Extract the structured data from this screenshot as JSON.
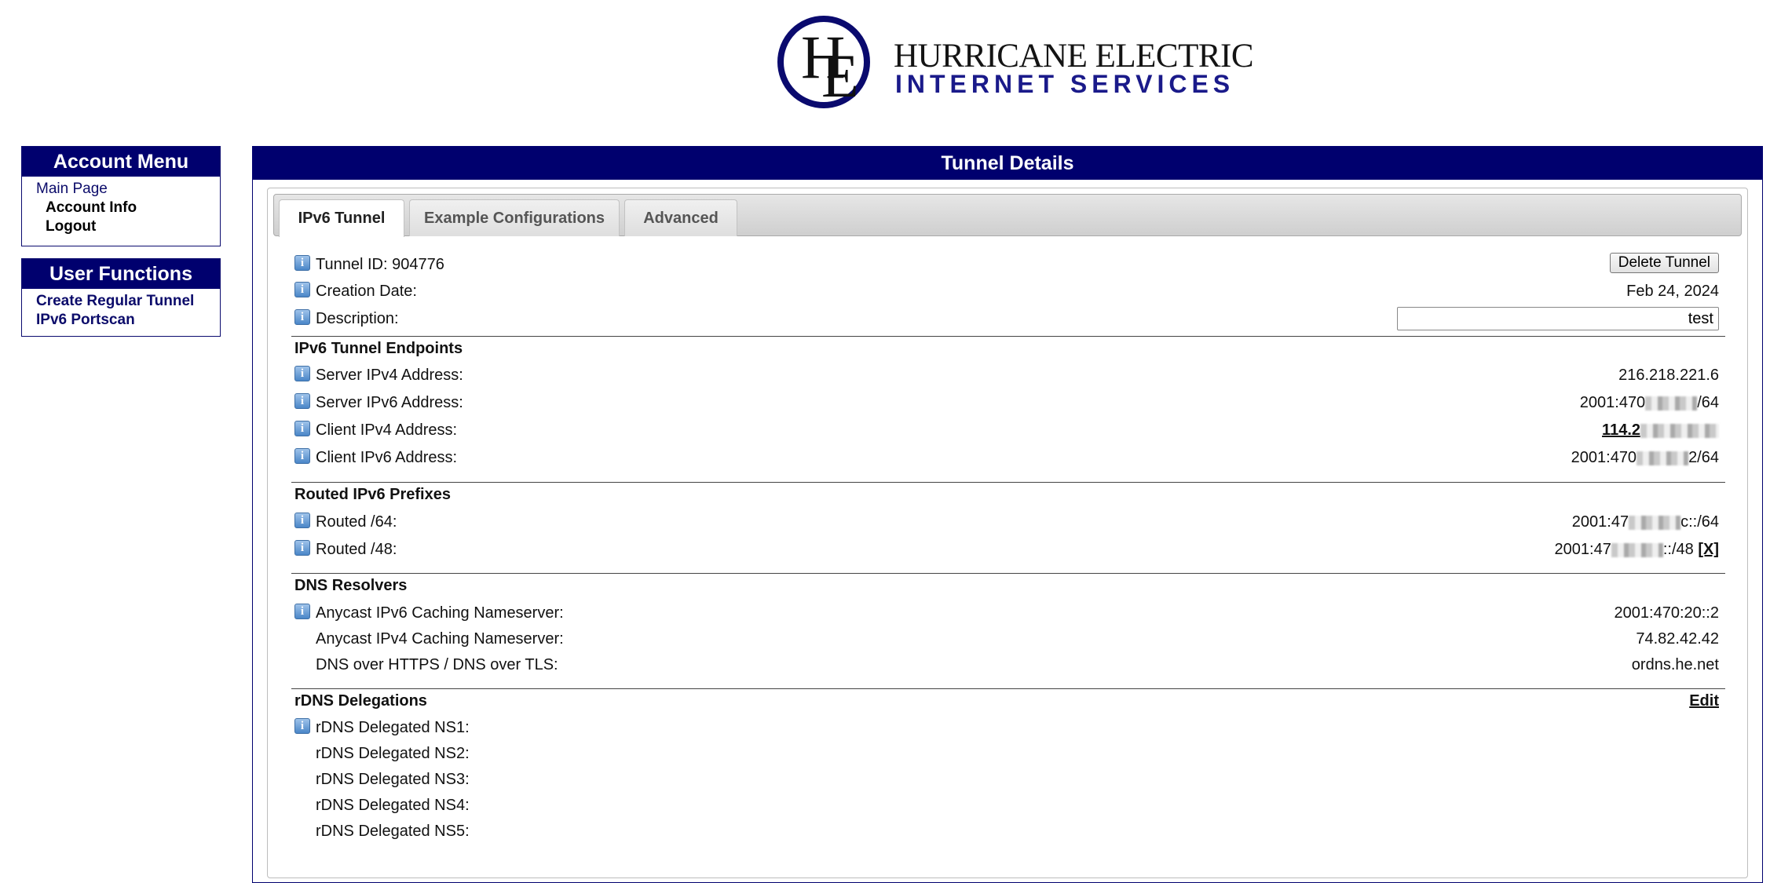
{
  "logo": {
    "mark_h": "H",
    "mark_e": "E",
    "line1": "HURRICANE ELECTRIC",
    "line2": "INTERNET SERVICES"
  },
  "account_menu": {
    "title": "Account Menu",
    "items": [
      "Main Page",
      "Account Info",
      "Logout"
    ]
  },
  "user_functions": {
    "title": "User Functions",
    "items": [
      "Create Regular Tunnel",
      "IPv6 Portscan"
    ]
  },
  "main": {
    "title": "Tunnel Details",
    "tabs": [
      "IPv6 Tunnel",
      "Example Configurations",
      "Advanced"
    ],
    "tunnel_id_label": "Tunnel ID: 904776",
    "delete_button": "Delete Tunnel",
    "creation_date_label": "Creation Date:",
    "creation_date_value": "Feb 24, 2024",
    "description_label": "Description:",
    "description_value": "test",
    "endpoints": {
      "title": "IPv6 Tunnel Endpoints",
      "server_ipv4_label": "Server IPv4 Address:",
      "server_ipv4_value": "216.218.221.6",
      "server_ipv6_label": "Server IPv6 Address:",
      "server_ipv6_prefix": "2001:470",
      "server_ipv6_suffix": "/64",
      "client_ipv4_label": "Client IPv4 Address:",
      "client_ipv4_prefix": "114.2",
      "client_ipv6_label": "Client IPv6 Address:",
      "client_ipv6_prefix": "2001:470",
      "client_ipv6_suffix": "2/64"
    },
    "routed": {
      "title": "Routed IPv6 Prefixes",
      "r64_label": "Routed /64:",
      "r64_prefix": "2001:47",
      "r64_suffix": "c::/64",
      "r48_label": "Routed /48:",
      "r48_prefix": "2001:47",
      "r48_suffix": "::/48",
      "r48_remove": "[X]"
    },
    "dns": {
      "title": "DNS Resolvers",
      "ipv6_label": "Anycast IPv6 Caching Nameserver:",
      "ipv6_value": "2001:470:20::2",
      "ipv4_label": "Anycast IPv4 Caching Nameserver:",
      "ipv4_value": "74.82.42.42",
      "doh_label": "DNS over HTTPS / DNS over TLS:",
      "doh_value": "ordns.he.net"
    },
    "rdns": {
      "title": "rDNS Delegations",
      "edit": "Edit",
      "ns": [
        "rDNS Delegated NS1:",
        "rDNS Delegated NS2:",
        "rDNS Delegated NS3:",
        "rDNS Delegated NS4:",
        "rDNS Delegated NS5:"
      ]
    }
  },
  "icons": {
    "info": "info-icon",
    "info_glyph": "i"
  },
  "colors": {
    "navy": "#00006e",
    "link": "#0b0b6a"
  }
}
